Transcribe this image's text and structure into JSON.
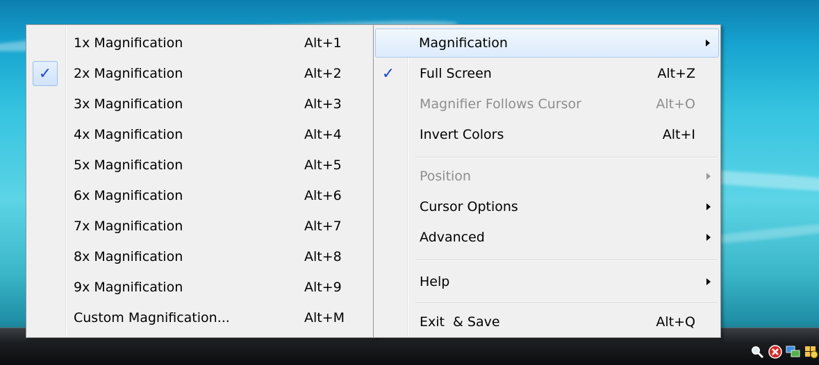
{
  "submenu": {
    "items": [
      {
        "label": "1x Magnification",
        "shortcut": "Alt+1",
        "checked": false
      },
      {
        "label": "2x Magnification",
        "shortcut": "Alt+2",
        "checked": true
      },
      {
        "label": "3x Magnification",
        "shortcut": "Alt+3",
        "checked": false
      },
      {
        "label": "4x Magnification",
        "shortcut": "Alt+4",
        "checked": false
      },
      {
        "label": "5x Magnification",
        "shortcut": "Alt+5",
        "checked": false
      },
      {
        "label": "6x Magnification",
        "shortcut": "Alt+6",
        "checked": false
      },
      {
        "label": "7x Magnification",
        "shortcut": "Alt+7",
        "checked": false
      },
      {
        "label": "8x Magnification",
        "shortcut": "Alt+8",
        "checked": false
      },
      {
        "label": "9x Magnification",
        "shortcut": "Alt+9",
        "checked": false
      },
      {
        "label": "Custom Magnification...",
        "shortcut": "Alt+M",
        "checked": false
      }
    ]
  },
  "mainmenu": {
    "magnification": {
      "label": "Magnification"
    },
    "full_screen": {
      "label": "Full Screen",
      "shortcut": "Alt+Z",
      "checked": true
    },
    "follows_cursor": {
      "label": "Magnifier Follows Cursor",
      "shortcut": "Alt+O",
      "enabled": false
    },
    "invert_colors": {
      "label": "Invert Colors",
      "shortcut": "Alt+I"
    },
    "position": {
      "label": "Position",
      "enabled": false
    },
    "cursor_options": {
      "label": "Cursor Options"
    },
    "advanced": {
      "label": "Advanced"
    },
    "help": {
      "label": "Help"
    },
    "exit_save": {
      "label": "Exit  & Save",
      "shortcut": "Alt+Q"
    }
  },
  "glyphs": {
    "check": "✓"
  },
  "colors": {
    "check": "#1f47c9",
    "menu_bg": "#f0f0f0",
    "hover_border": "#a9c9ef"
  },
  "tray_icons": [
    "magnifier-icon",
    "security-alert-icon",
    "network-icon",
    "windows-update-icon"
  ]
}
